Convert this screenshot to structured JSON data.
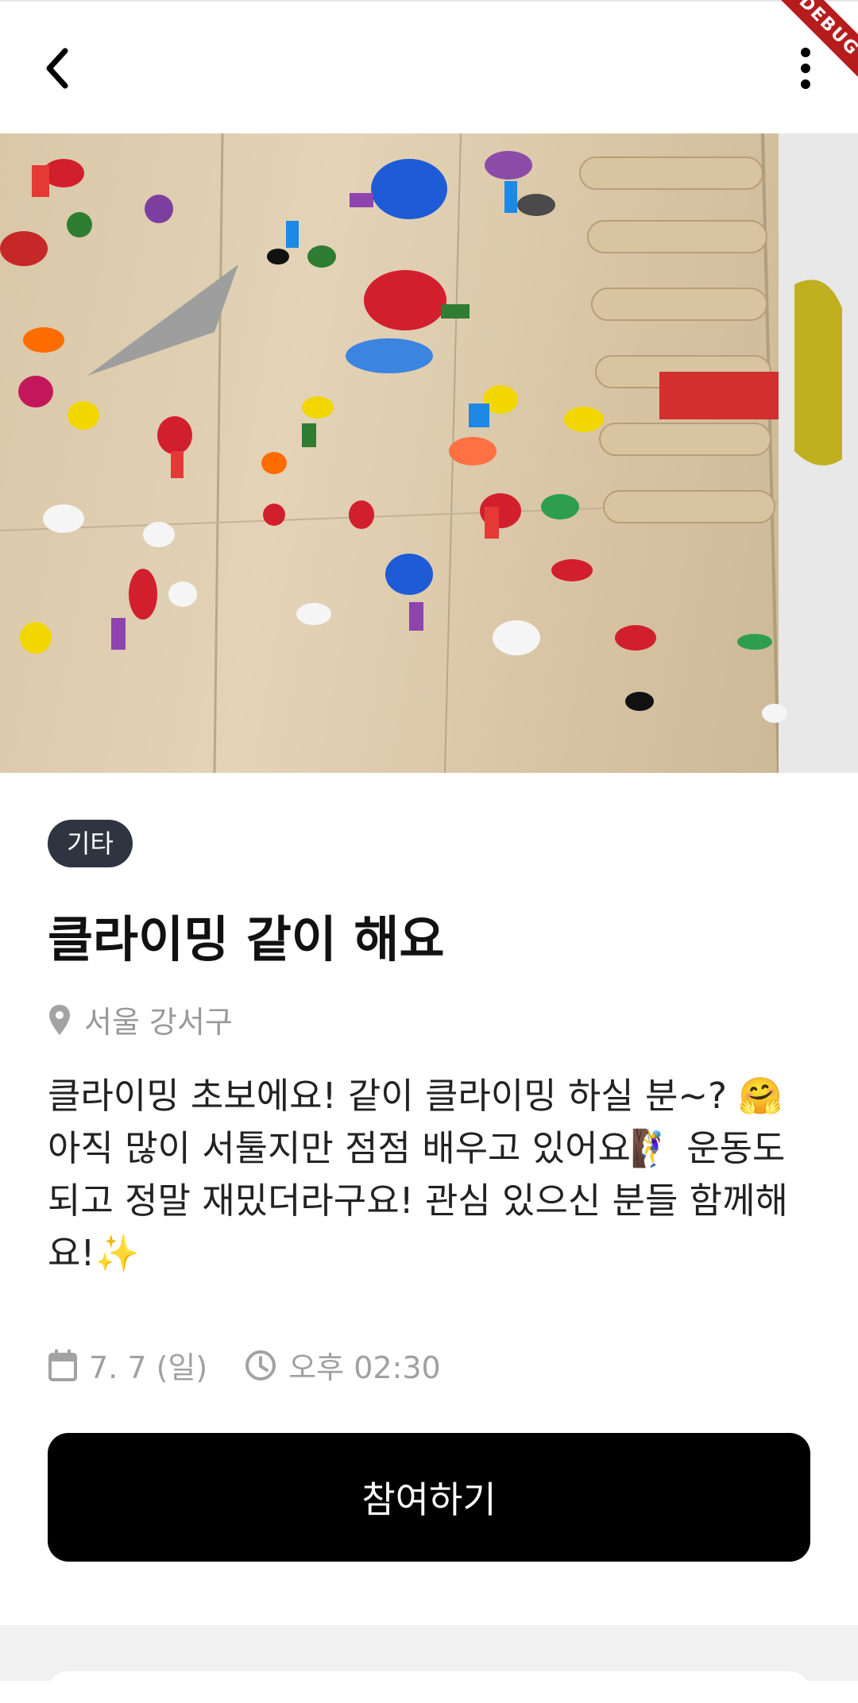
{
  "appbar": {
    "back_icon": "chevron-left-icon",
    "more_icon": "more-vertical-icon",
    "debug_banner": "DEBUG"
  },
  "hero": {
    "description_icon": "climbing-wall-photo"
  },
  "post": {
    "category": "기타",
    "title": "클라이밍 같이 해요",
    "location": "서울 강서구",
    "body": "클라이밍 초보에요! 같이 클라이밍 하실 분~? 🤗\n아직 많이 서툴지만 점점 배우고 있어요🧗‍♀️ 운동도\n되고 정말 재밌더라구요! 관심 있으신 분들 함께해\n요!✨",
    "date": "7. 7 (일)",
    "time": "오후 02:30"
  },
  "actions": {
    "join_label": "참여하기"
  },
  "colors": {
    "chip_bg": "#2e3440",
    "button_bg": "#000000",
    "meta_gray": "#a0a0a0"
  }
}
